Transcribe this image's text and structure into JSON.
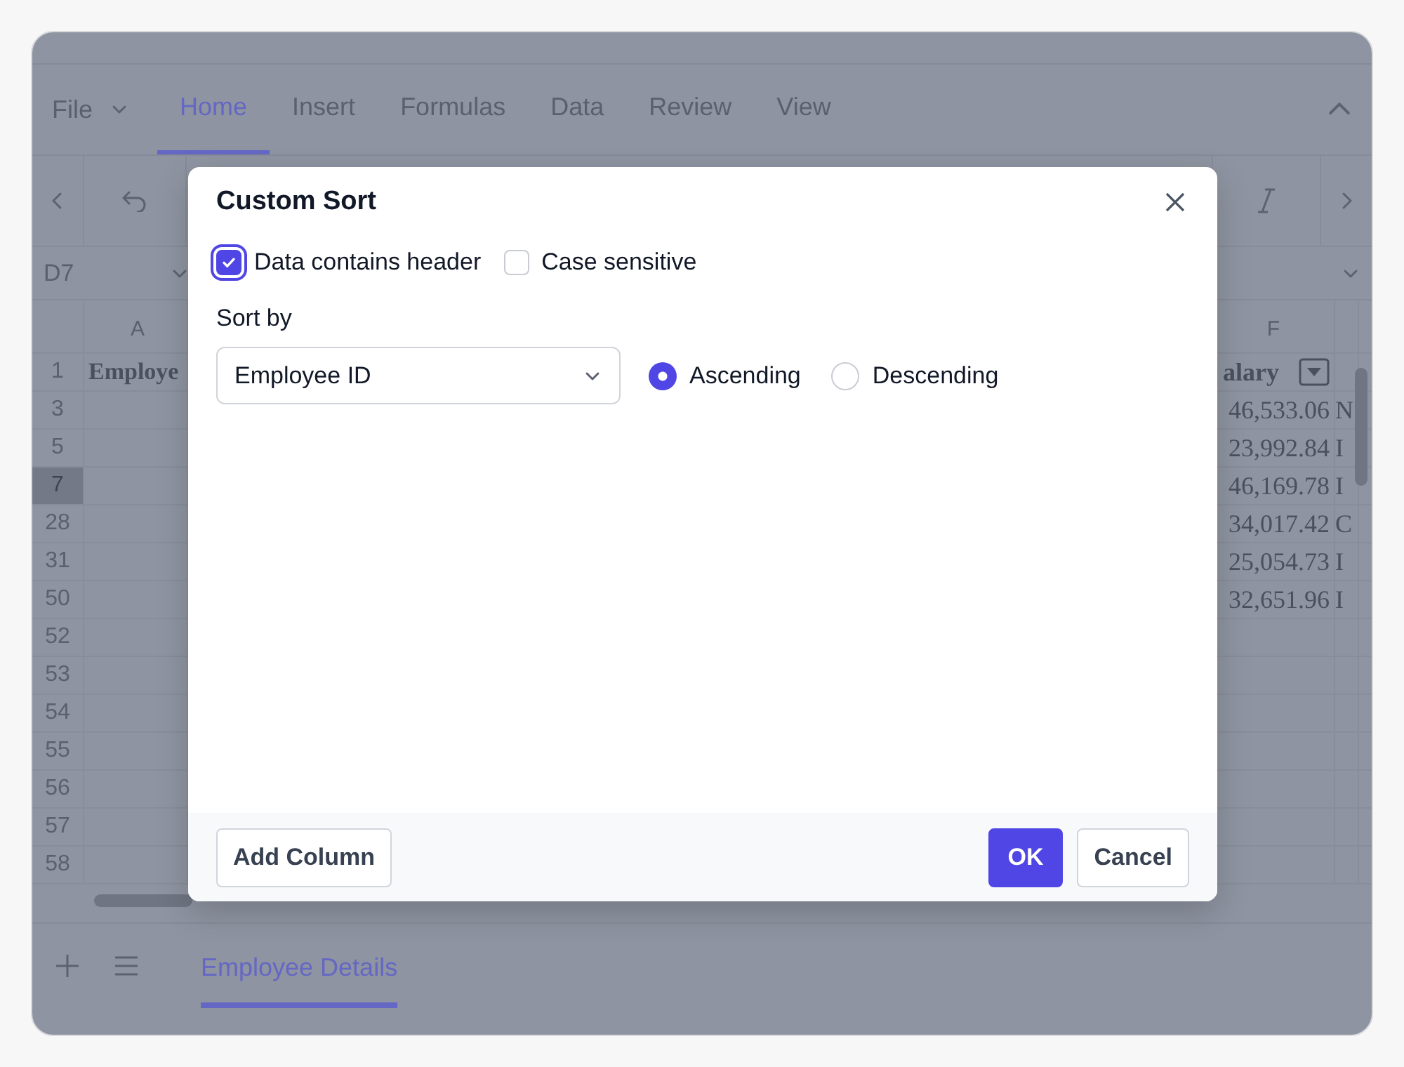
{
  "ribbon": {
    "file_menu": "File",
    "tabs": [
      {
        "label": "Home",
        "selected": true
      },
      {
        "label": "Insert",
        "selected": false
      },
      {
        "label": "Formulas",
        "selected": false
      },
      {
        "label": "Data",
        "selected": false
      },
      {
        "label": "Review",
        "selected": false
      },
      {
        "label": "View",
        "selected": false
      }
    ]
  },
  "name_box": "D7",
  "grid": {
    "column_headers": [
      "A",
      "F"
    ],
    "rows": [
      {
        "number": "1",
        "selected": false,
        "cell_a": "Employe",
        "cell_f": "alary",
        "cell_g": ""
      },
      {
        "number": "3",
        "selected": false,
        "cell_f": "46,533.06",
        "cell_g": "N"
      },
      {
        "number": "5",
        "selected": false,
        "cell_f": "23,992.84",
        "cell_g": "I"
      },
      {
        "number": "7",
        "selected": true,
        "cell_f": "46,169.78",
        "cell_g": "I"
      },
      {
        "number": "28",
        "selected": false,
        "cell_f": "34,017.42",
        "cell_g": "C"
      },
      {
        "number": "31",
        "selected": false,
        "cell_f": "25,054.73",
        "cell_g": "I"
      },
      {
        "number": "50",
        "selected": false,
        "cell_f": "32,651.96",
        "cell_g": "I"
      },
      {
        "number": "52",
        "selected": false
      },
      {
        "number": "53",
        "selected": false
      },
      {
        "number": "54",
        "selected": false
      },
      {
        "number": "55",
        "selected": false
      },
      {
        "number": "56",
        "selected": false
      },
      {
        "number": "57",
        "selected": false
      },
      {
        "number": "58",
        "selected": false
      }
    ]
  },
  "sheet_tabs": [
    {
      "label": "Employee Details",
      "selected": true
    }
  ],
  "dialog": {
    "title": "Custom Sort",
    "options": [
      {
        "label": "Data contains header",
        "checked": true
      },
      {
        "label": "Case sensitive",
        "checked": false
      }
    ],
    "sort_by_label": "Sort by",
    "sort_by_value": "Employee ID",
    "orders": [
      {
        "label": "Ascending",
        "selected": true
      },
      {
        "label": "Descending",
        "selected": false
      }
    ],
    "buttons": [
      {
        "label": "Add Column",
        "kind": "secondary"
      },
      {
        "label": "OK",
        "kind": "primary"
      },
      {
        "label": "Cancel",
        "kind": "secondary"
      }
    ]
  }
}
